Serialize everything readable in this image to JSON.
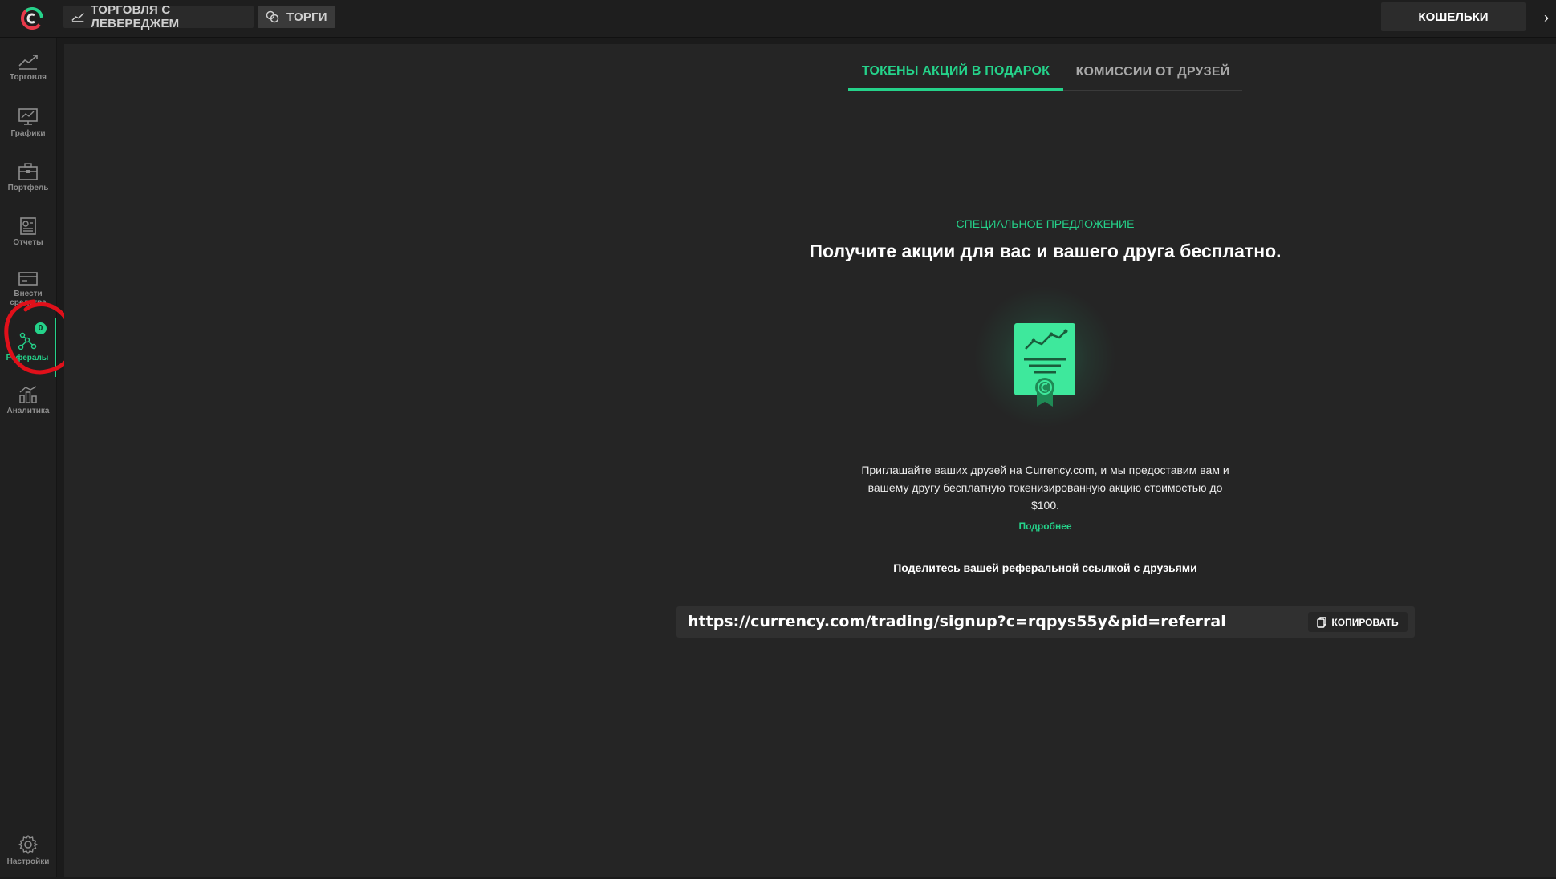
{
  "topbar": {
    "logo": "currency-com-logo",
    "tabs": [
      {
        "label": "ТОРГОВЛЯ С ЛЕВЕРЕДЖЕМ",
        "icon": "trend-line-icon"
      },
      {
        "label": "ТОРГИ",
        "icon": "coins-icon"
      }
    ],
    "wallets_label": "КОШЕЛЬКИ",
    "expand_arrow": "›"
  },
  "sidebar": {
    "items": [
      {
        "label": "Торговля",
        "icon": "trading-icon"
      },
      {
        "label": "Графики",
        "icon": "charts-icon"
      },
      {
        "label": "Портфель",
        "icon": "portfolio-icon"
      },
      {
        "label": "Отчеты",
        "icon": "reports-icon"
      },
      {
        "label": "Внести средства",
        "icon": "deposit-icon"
      },
      {
        "label": "Рефералы",
        "icon": "referrals-icon",
        "badge": "0",
        "active": true
      },
      {
        "label": "Аналитика",
        "icon": "analytics-icon"
      }
    ],
    "settings_label": "Настройки"
  },
  "referral": {
    "tabs": [
      "ТОКЕНЫ АКЦИЙ В ПОДАРОК",
      "КОМИССИИ ОТ ДРУЗЕЙ"
    ],
    "eyebrow": "СПЕЦИАЛЬНОЕ ПРЕДЛОЖЕНИЕ",
    "headline": "Получите акции для вас и вашего друга бесплатно.",
    "description": "Приглашайте ваших друзей на Currency.com, и мы предоставим вам и вашему другу бесплатную токенизированную акцию стоимостью до $100.",
    "more_link": "Подробнее",
    "share_title": "Поделитесь вашей реферальной ссылкой с друзьями",
    "link": "https://currency.com/trading/signup?c=rqpys55y&pid=referral",
    "copy_label": "КОПИРОВАТЬ"
  },
  "colors": {
    "accent": "#25d28a",
    "annotation": "#e0101a",
    "background": "#252525"
  }
}
